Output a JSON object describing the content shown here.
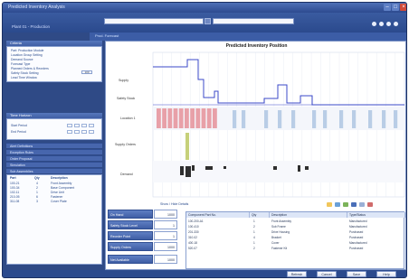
{
  "window": {
    "title": "Predicted Inventory Analysis"
  },
  "toolbar": {
    "plant_label": "Plant 01 - Production",
    "search_placeholder": "",
    "filter_placeholder": ""
  },
  "tabs": {
    "active": "Prod. Forecast"
  },
  "sidebar": {
    "section1": {
      "title": "Criteria",
      "rows": [
        "Part: Production Module",
        "Location Group Setting",
        "Demand Source",
        "Forecast Type",
        "Planned Orders & Reorders",
        "Safety Stock Setting",
        "Lead Time Window"
      ],
      "value": "100"
    },
    "section2": {
      "title": "Time Horizon",
      "rows": [
        "Start Period",
        "End Period"
      ]
    },
    "nav": [
      "Alert Definitions",
      "Exception Rules",
      "Order Proposal",
      "Simulation",
      "Sub Assemblies"
    ],
    "list": {
      "headers": [
        "Part",
        "Qty",
        "Description"
      ],
      "rows": [
        [
          "100-21",
          "4",
          "Front Assembly"
        ],
        [
          "100-34",
          "2",
          "Base Component"
        ],
        [
          "102-11",
          "1",
          "Drive Unit"
        ],
        [
          "210-05",
          "6",
          "Fastener"
        ],
        [
          "311-08",
          "3",
          "Cover Plate"
        ]
      ]
    }
  },
  "chart": {
    "title": "Predicted Inventory Position",
    "y_labels": [
      "Supply",
      "Safety Stock",
      "Location 1",
      "Supply Orders",
      "Demand"
    ],
    "legend_link": "Show / Hide Details"
  },
  "summary": [
    {
      "label": "On Hand",
      "value": "1000"
    },
    {
      "label": "Safety Stock Level",
      "value": "1"
    },
    {
      "label": "Reorder Point",
      "value": "1"
    },
    {
      "label": "Supply Orders",
      "value": "1000"
    },
    {
      "label": "Net Available",
      "value": "1000"
    }
  ],
  "details": {
    "label": "Components",
    "headers": [
      "Component Part No.",
      "Qty",
      "Description",
      "Type/Status"
    ],
    "rows": [
      [
        "100-200-A1",
        "1",
        "Front Assembly",
        "Manufactured"
      ],
      [
        "100-410",
        "2",
        "Sub Frame",
        "Manufactured"
      ],
      [
        "201-330",
        "1",
        "Drive Housing",
        "Purchased"
      ],
      [
        "310-02",
        "4",
        "Bracket",
        "Purchased"
      ],
      [
        "400-18",
        "1",
        "Cover",
        "Manufactured"
      ],
      [
        "520-07",
        "2",
        "Fastener Kit",
        "Purchased"
      ]
    ]
  },
  "buttons": [
    "Refresh",
    "Cancel",
    "Save",
    "Help"
  ],
  "colors": {
    "frame": "#2f4a86",
    "supply_line": "#3b49c9",
    "pink_bars": "#e8a0a8",
    "blue_bars": "#b9cde6",
    "demand_bars": "#2f2f2f",
    "highlight": "#c6d07a"
  }
}
